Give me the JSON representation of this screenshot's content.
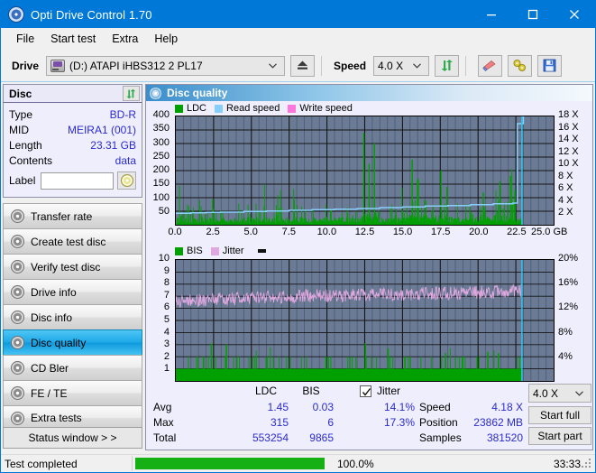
{
  "window": {
    "title": "Opti Drive Control 1.70",
    "app_icon": "disc-icon",
    "minimize": "—",
    "maximize": "☐",
    "close": "✕"
  },
  "menu": {
    "items": [
      "File",
      "Start test",
      "Extra",
      "Help"
    ]
  },
  "toolbar": {
    "drive_label": "Drive",
    "drive_value": "(D:)  ATAPI iHBS312  2 PL17",
    "eject_icon": "eject-icon",
    "speed_label": "Speed",
    "speed_value": "4.0 X",
    "refresh_icon": "refresh-icon",
    "erase_icon": "eraser-icon",
    "tools_icon": "tools-icon",
    "save_icon": "save-icon"
  },
  "disc_panel": {
    "title": "Disc",
    "refresh_icon": "refresh-icon",
    "rows": [
      {
        "key": "Type",
        "value": "BD-R"
      },
      {
        "key": "MID",
        "value": "MEIRA1 (001)"
      },
      {
        "key": "Length",
        "value": "23.31 GB"
      },
      {
        "key": "Contents",
        "value": "data"
      }
    ],
    "label_key": "Label",
    "label_value": "",
    "label_placeholder": "",
    "disc_button_icon": "disc-icon"
  },
  "nav": {
    "items": [
      {
        "label": "Transfer rate",
        "icon": "disc-transfer-icon",
        "active": false
      },
      {
        "label": "Create test disc",
        "icon": "disc-create-icon",
        "active": false
      },
      {
        "label": "Verify test disc",
        "icon": "disc-verify-icon",
        "active": false
      },
      {
        "label": "Drive info",
        "icon": "disc-drive-icon",
        "active": false
      },
      {
        "label": "Disc info",
        "icon": "disc-info-icon",
        "active": false
      },
      {
        "label": "Disc quality",
        "icon": "disc-quality-icon",
        "active": true
      },
      {
        "label": "CD Bler",
        "icon": "disc-bler-icon",
        "active": false
      },
      {
        "label": "FE / TE",
        "icon": "disc-fete-icon",
        "active": false
      },
      {
        "label": "Extra tests",
        "icon": "disc-extra-icon",
        "active": false
      }
    ],
    "status_window_label": "Status window > >"
  },
  "content": {
    "header_title": "Disc quality",
    "header_icon": "disc-quality-icon"
  },
  "stats": {
    "col_ldc": "LDC",
    "col_bis": "BIS",
    "row_avg": "Avg",
    "row_max": "Max",
    "row_total": "Total",
    "ldc_avg": "1.45",
    "ldc_max": "315",
    "ldc_total": "553254",
    "bis_avg": "0.03",
    "bis_max": "6",
    "bis_total": "9865",
    "jitter_label": "Jitter",
    "jitter_checked": true,
    "jitter_avg": "14.1%",
    "jitter_max": "17.3%",
    "speed_label": "Speed",
    "speed_value": "4.18 X",
    "position_label": "Position",
    "position_value": "23862 MB",
    "samples_label": "Samples",
    "samples_value": "381520",
    "speed_select": "4.0 X",
    "start_full": "Start full",
    "start_part": "Start part"
  },
  "statusbar": {
    "text": "Test completed",
    "percent": "100.0%",
    "progress": 100,
    "elapsed": "33:33",
    "progress_color": "#14b014"
  },
  "chart_data": [
    {
      "id": "top",
      "type": "line",
      "title": "",
      "xlabel": "GB",
      "ylabel": "",
      "xlim": [
        0,
        25
      ],
      "ylim": [
        0,
        400
      ],
      "y2lim": [
        0,
        18
      ],
      "grid": true,
      "legend_position": "top-left",
      "legend": [
        {
          "name": "LDC",
          "color": "#00a000"
        },
        {
          "name": "Read speed",
          "color": "#87cefa"
        },
        {
          "name": "Write speed",
          "color": "#ff77dd"
        }
      ],
      "xticks": [
        "0.0",
        "2.5",
        "5.0",
        "7.5",
        "10.0",
        "12.5",
        "15.0",
        "17.5",
        "20.0",
        "22.5",
        "25.0"
      ],
      "xunit": "GB",
      "yticks": [
        400,
        350,
        300,
        250,
        200,
        150,
        100,
        50
      ],
      "y2ticks": [
        "18 X",
        "16 X",
        "14 X",
        "12 X",
        "10 X",
        "8 X",
        "6 X",
        "4 X",
        "2 X"
      ],
      "series": [
        {
          "name": "Read speed",
          "color": "#87cefa",
          "x": [
            0.0,
            1.0,
            2.0,
            3.0,
            4.5,
            6.0,
            7.5,
            9.0,
            10.5,
            12.0,
            13.5,
            15.0,
            16.5,
            18.0,
            19.5,
            21.0,
            22.3,
            22.6,
            23.0
          ],
          "y": [
            1.9,
            2.0,
            2.05,
            2.1,
            2.2,
            2.3,
            2.4,
            2.5,
            2.6,
            2.7,
            2.85,
            2.95,
            3.1,
            3.2,
            3.35,
            3.5,
            3.6,
            16.8,
            18.0
          ]
        },
        {
          "name": "LDC",
          "color": "#00a000",
          "note": "dense vertical spike bars along full width, baseline ~20, typical peaks 40-120, large spikes at 2.4, 12.6, 12.9, 13.2, 15.6, 17.6, 20.3, 22.2",
          "spikes": [
            {
              "x": 2.4,
              "y": 95
            },
            {
              "x": 12.4,
              "y": 340
            },
            {
              "x": 12.75,
              "y": 225
            },
            {
              "x": 13.1,
              "y": 300
            },
            {
              "x": 15.6,
              "y": 240
            },
            {
              "x": 16.0,
              "y": 170
            },
            {
              "x": 17.5,
              "y": 200
            },
            {
              "x": 17.9,
              "y": 140
            },
            {
              "x": 20.3,
              "y": 120
            },
            {
              "x": 21.4,
              "y": 160
            },
            {
              "x": 22.1,
              "y": 180
            },
            {
              "x": 22.4,
              "y": 130
            }
          ]
        }
      ],
      "marker_line": {
        "x": 22.9,
        "color": "#22c8f0"
      }
    },
    {
      "id": "bottom",
      "type": "line",
      "title": "",
      "xlabel": "GB",
      "ylabel": "",
      "xlim": [
        0,
        25
      ],
      "ylim": [
        0,
        10
      ],
      "y2lim": [
        0,
        20
      ],
      "grid": true,
      "legend_position": "top-left",
      "legend": [
        {
          "name": "BIS",
          "color": "#00a000"
        },
        {
          "name": "Jitter",
          "color": "#e0a8e0"
        }
      ],
      "xticks": [
        "0.0",
        "2.5",
        "5.0",
        "7.5",
        "10.0",
        "12.5",
        "15.0",
        "17.5",
        "20.0",
        "22.5",
        "25.0"
      ],
      "xunit": "GB",
      "yticks": [
        10,
        9,
        8,
        7,
        6,
        5,
        4,
        3,
        2,
        1
      ],
      "y2ticks": [
        "20%",
        "16%",
        "12%",
        "8%",
        "4%"
      ],
      "series": [
        {
          "name": "Jitter",
          "color": "#e0a8e0",
          "note": "noisy band oscillating roughly between 6.0 and 7.6 (12%-15.4%), slowly rising left-to-right",
          "x": [
            0.0,
            2.0,
            4.0,
            6.0,
            8.0,
            10.0,
            12.0,
            14.0,
            16.0,
            18.0,
            20.0,
            22.0,
            22.9
          ],
          "y": [
            6.5,
            6.7,
            6.8,
            6.9,
            7.0,
            7.05,
            7.1,
            7.15,
            7.2,
            7.25,
            7.3,
            7.4,
            7.5
          ],
          "noise": 0.55
        },
        {
          "name": "BIS",
          "color": "#00a000",
          "note": "solid filled baseline at ~1 across the whole disc with frequent spikes to 2, occasional to 3",
          "baseline": 1.0,
          "spikes": [
            {
              "x": 2.3,
              "y": 3.1
            },
            {
              "x": 3.3,
              "y": 3.0
            },
            {
              "x": 12.5,
              "y": 3.1
            },
            {
              "x": 14.0,
              "y": 2.7
            },
            {
              "x": 17.8,
              "y": 2.3
            },
            {
              "x": 20.6,
              "y": 2.4
            },
            {
              "x": 21.3,
              "y": 2.3
            }
          ]
        }
      ],
      "marker_line": {
        "x": 22.9,
        "color": "#22c8f0"
      }
    }
  ]
}
